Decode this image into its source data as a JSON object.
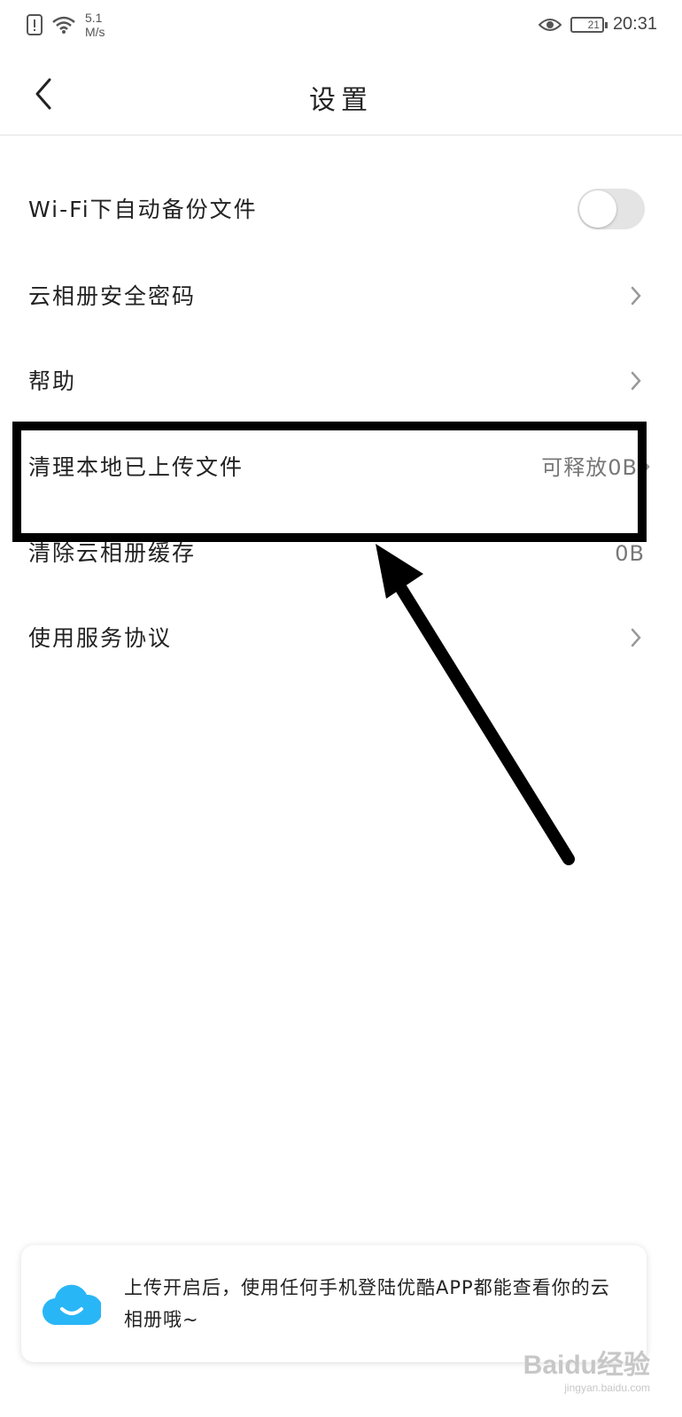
{
  "status_bar": {
    "speed_value": "5.1",
    "speed_unit": "M/s",
    "battery": "21",
    "time": "20:31"
  },
  "header": {
    "title": "设置"
  },
  "settings": {
    "wifi_backup": {
      "label": "Wi-Fi下自动备份文件",
      "enabled": false
    },
    "cloud_password": {
      "label": "云相册安全密码"
    },
    "help": {
      "label": "帮助"
    },
    "clean_local": {
      "label": "清理本地已上传文件",
      "value": "可释放0B"
    },
    "clear_cache": {
      "label": "清除云相册缓存",
      "value": "0B"
    },
    "service_agreement": {
      "label": "使用服务协议"
    }
  },
  "banner": {
    "text": "上传开启后，使用任何手机登陆优酷APP都能查看你的云相册哦~"
  },
  "watermark": {
    "brand": "Baidu经验",
    "url": "jingyan.baidu.com"
  },
  "colors": {
    "annotation": "#000000",
    "cloud": "#29b6f6",
    "toggle_off": "#e4e4e4"
  }
}
